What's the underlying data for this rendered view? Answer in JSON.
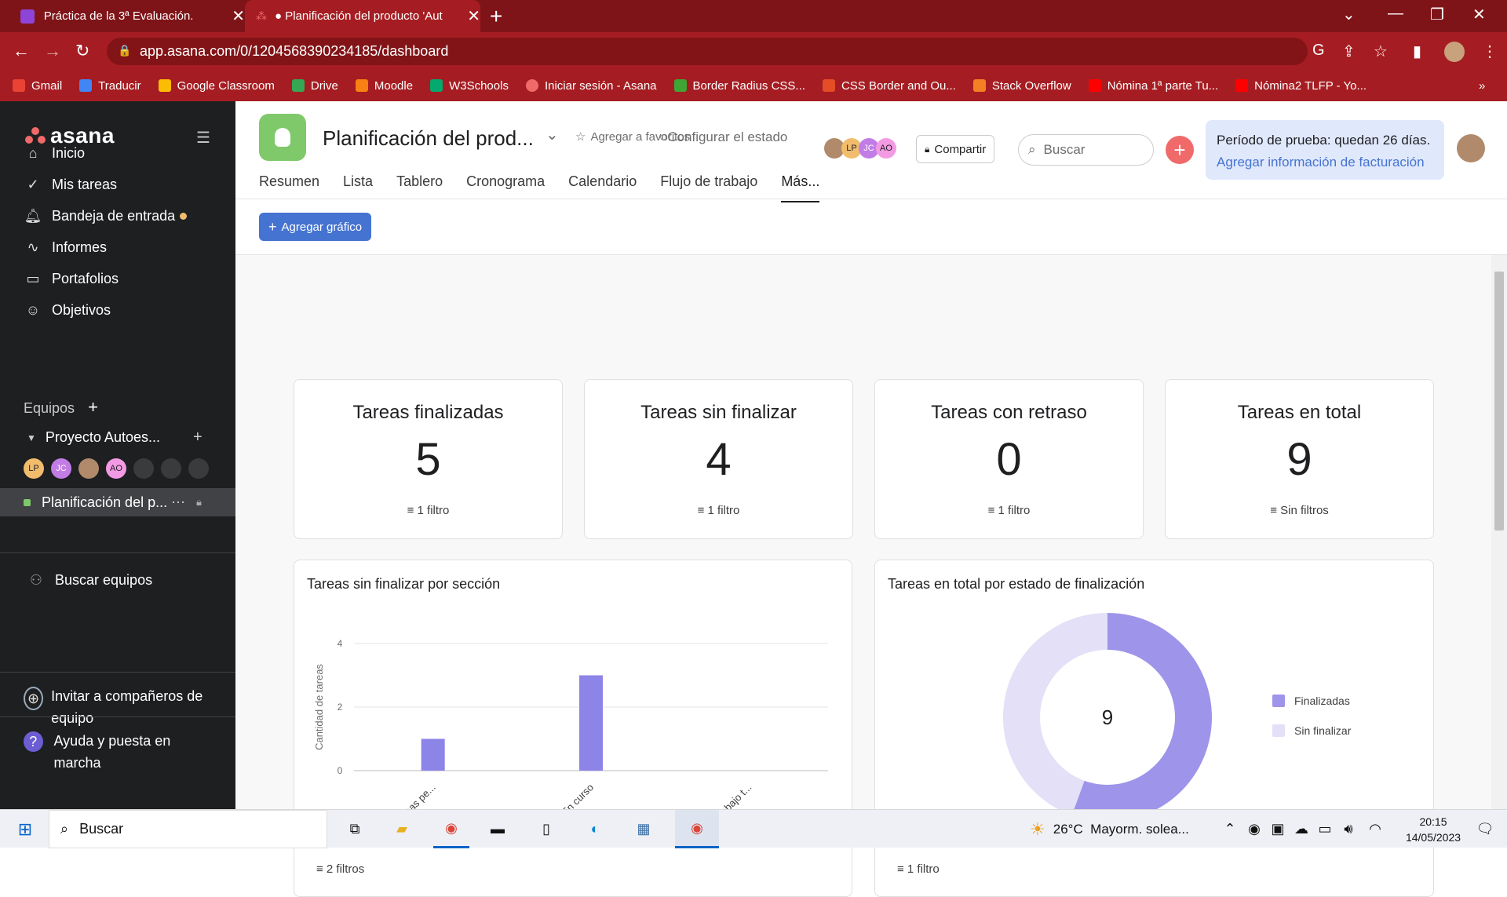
{
  "browser": {
    "tabs": [
      {
        "title": "Práctica de la 3ª Evaluación.",
        "favicon_color": "#8e44d6"
      },
      {
        "title": "● Planificación del producto 'Aut",
        "favicon_color": "#f06a6a"
      }
    ],
    "url": "app.asana.com/0/1204568390234185/dashboard",
    "bookmarks": [
      {
        "label": "Gmail",
        "color": "#ea4335"
      },
      {
        "label": "Traducir",
        "color": "#4285f4"
      },
      {
        "label": "Google Classroom",
        "color": "#fbbc04"
      },
      {
        "label": "Drive",
        "color": "#34a853"
      },
      {
        "label": "Moodle",
        "color": "#f98012"
      },
      {
        "label": "W3Schools",
        "color": "#04aa6d"
      },
      {
        "label": "Iniciar sesión - Asana",
        "color": "#f06a6a"
      },
      {
        "label": "Border Radius CSS...",
        "color": "#3fa535"
      },
      {
        "label": "CSS Border and Ou...",
        "color": "#e44d26"
      },
      {
        "label": "Stack Overflow",
        "color": "#f48024"
      },
      {
        "label": "Nómina 1ª parte Tu...",
        "color": "#ff0000"
      },
      {
        "label": "Nómina2 TLFP - Yo...",
        "color": "#ff0000"
      }
    ],
    "bookmarks_more": "»"
  },
  "sidebar": {
    "logo": "asana",
    "nav": [
      {
        "label": "Inicio",
        "icon": "home-icon"
      },
      {
        "label": "Mis tareas",
        "icon": "check-circle-icon"
      },
      {
        "label": "Bandeja de entrada",
        "icon": "bell-icon"
      },
      {
        "label": "Informes",
        "icon": "chart-line-icon"
      },
      {
        "label": "Portafolios",
        "icon": "folder-icon"
      },
      {
        "label": "Objetivos",
        "icon": "person-icon"
      }
    ],
    "teams_label": "Equipos",
    "team_name": "Proyecto Autoes...",
    "team_members": [
      "LP",
      "JC",
      "",
      "AO"
    ],
    "project_item": "Planificación del p...",
    "find_teams": "Buscar equipos",
    "invite": "Invitar a compañeros de equipo",
    "help": "Ayuda y puesta en marcha"
  },
  "header": {
    "project_title": "Planificación del prod...",
    "favorite": "Agregar a favoritos",
    "status": "Configurar el estado",
    "share": "Compartir",
    "search_placeholder": "Buscar",
    "trial_line1": "Período de prueba: quedan 26 días.",
    "trial_line2": "Agregar información de facturación",
    "members": [
      "LP",
      "JC",
      "AO"
    ]
  },
  "tabs": [
    "Resumen",
    "Lista",
    "Tablero",
    "Cronograma",
    "Calendario",
    "Flujo de trabajo",
    "Más..."
  ],
  "add_chart": "Agregar gráfico",
  "stats": [
    {
      "title": "Tareas finalizadas",
      "value": "5",
      "filter": "1 filtro"
    },
    {
      "title": "Tareas sin finalizar",
      "value": "4",
      "filter": "1 filtro"
    },
    {
      "title": "Tareas con retraso",
      "value": "0",
      "filter": "1 filtro"
    },
    {
      "title": "Tareas en total",
      "value": "9",
      "filter": "Sin filtros"
    }
  ],
  "chart_data": [
    {
      "type": "bar",
      "title": "Tareas sin finalizar por sección",
      "ylabel": "Cantidad de tareas",
      "xlabel": "",
      "categories": [
        "Tareas pe...",
        "En curso",
        "Trabajo t..."
      ],
      "values": [
        1,
        3,
        0
      ],
      "ylim": [
        0,
        4
      ],
      "yticks": [
        0,
        2,
        4
      ],
      "color": "#8d84e8",
      "footer": "2 filtros"
    },
    {
      "type": "pie",
      "title": "Tareas en total por estado de finalización",
      "center_label": "9",
      "labels": [
        "Finalizadas",
        "Sin finalizar"
      ],
      "values": [
        5,
        4
      ],
      "colors": [
        "#9e94ea",
        "#e3e0f7"
      ],
      "legend": "right",
      "footer": "1 filtro"
    }
  ],
  "taskbar": {
    "search": "Buscar",
    "weather": "26°C  Mayorm. solea...",
    "time": "20:15",
    "date": "14/05/2023"
  }
}
